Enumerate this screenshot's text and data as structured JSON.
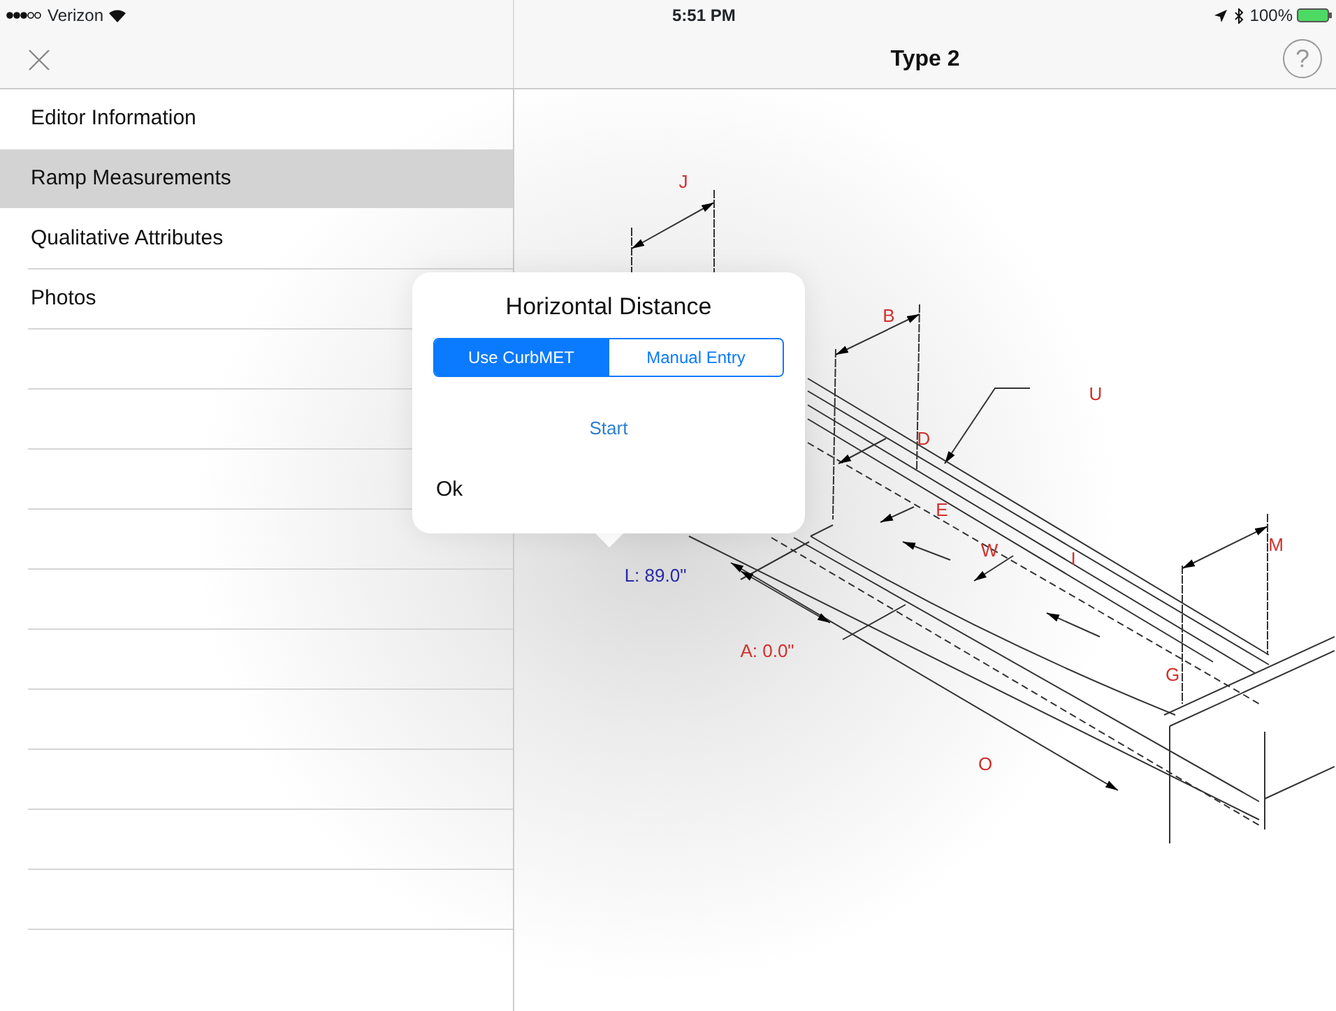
{
  "status_bar": {
    "carrier": "Verizon",
    "time": "5:51 PM",
    "battery": "100%"
  },
  "nav": {
    "title": "Type 2",
    "help": "?"
  },
  "sidebar": {
    "items": [
      {
        "label": "Editor Information",
        "selected": false
      },
      {
        "label": "Ramp Measurements",
        "selected": true
      },
      {
        "label": "Qualitative Attributes",
        "selected": false
      },
      {
        "label": "Photos",
        "selected": false
      }
    ]
  },
  "popover": {
    "title": "Horizontal Distance",
    "segments": [
      {
        "label": "Use CurbMET",
        "selected": true
      },
      {
        "label": "Manual Entry",
        "selected": false
      }
    ],
    "action": "Start",
    "confirm": "Ok"
  },
  "diagram": {
    "labels": [
      {
        "text": "J",
        "color": "#d0312d"
      },
      {
        "text": "B",
        "color": "#d0312d"
      },
      {
        "text": "U",
        "color": "#d0312d"
      },
      {
        "text": "D",
        "color": "#d0312d"
      },
      {
        "text": "E",
        "color": "#d0312d"
      },
      {
        "text": "W",
        "color": "#d0312d"
      },
      {
        "text": "I",
        "color": "#d0312d"
      },
      {
        "text": "M",
        "color": "#d0312d"
      },
      {
        "text": "L: 89.0\"",
        "color": "#2a2aa8"
      },
      {
        "text": "G",
        "color": "#d0312d"
      },
      {
        "text": "A: 0.0\"",
        "color": "#d0312d"
      },
      {
        "text": "O",
        "color": "#d0312d"
      }
    ]
  }
}
